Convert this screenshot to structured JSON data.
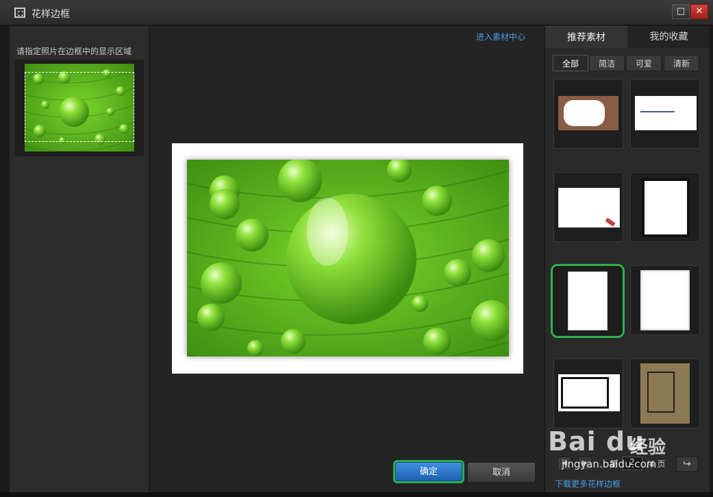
{
  "window": {
    "title": "花样边框",
    "maximize_glyph": "□",
    "close_glyph": "✕"
  },
  "left": {
    "label": "请指定照片在边框中的显示区域"
  },
  "center": {
    "material_link": "进入素材中心",
    "ok_label": "确定",
    "cancel_label": "取消"
  },
  "right": {
    "tabs": [
      {
        "label": "推荐素材",
        "active": true
      },
      {
        "label": "我的收藏",
        "active": false
      }
    ],
    "categories": [
      {
        "label": "全部",
        "active": true
      },
      {
        "label": "简洁",
        "active": false
      },
      {
        "label": "可爱",
        "active": false
      },
      {
        "label": "清新",
        "active": false
      }
    ],
    "selected_tile_index": 4,
    "pager": {
      "prev_glyph": "◀",
      "next_glyph": "▶",
      "page_prefix": "第",
      "current_page": "2",
      "page_suffix": "/4 页",
      "go_glyph": "↪"
    },
    "download_link": "下载更多花样边框"
  },
  "watermark": {
    "brand": "Bai du",
    "jingyan": "经验",
    "url": "jingyan.baidu.com"
  },
  "colors": {
    "accent_blue": "#4a9fe0",
    "selection_green": "#2bb14a",
    "ok_blue": "#2f77c8"
  }
}
